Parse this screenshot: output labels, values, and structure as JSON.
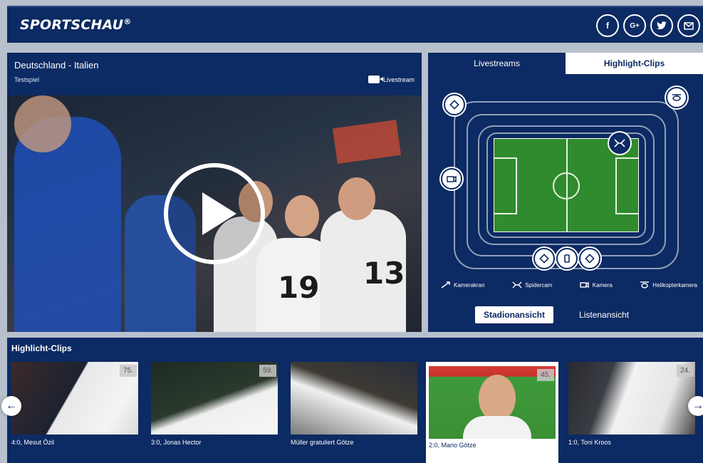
{
  "header": {
    "logo": "SPORTSCHAU",
    "logo_mark": "®",
    "social": [
      {
        "label": "f",
        "icon": "facebook-icon"
      },
      {
        "label": "G+",
        "icon": "google-plus-icon"
      },
      {
        "label": "",
        "icon": "twitter-icon"
      },
      {
        "label": "",
        "icon": "mail-icon"
      }
    ]
  },
  "video": {
    "title": "Deutschland - Italien",
    "subtitle": "Testspiel",
    "livestream_label": "Livestream"
  },
  "stadium": {
    "tabs": {
      "livestreams": "Livestreams",
      "highlights": "Highlight-Clips"
    },
    "legend": {
      "kamerakran": "Kamerakran",
      "spidercam": "Spidercam",
      "kamera": "Kamera",
      "helikopter": "Helikopterkamera"
    },
    "views": {
      "stadion": "Stadionansicht",
      "liste": "Listenansicht"
    }
  },
  "clips": {
    "title": "Highlicht-Clips",
    "items": [
      {
        "minute": "75.",
        "caption": "4:0, Mesut Özil"
      },
      {
        "minute": "59.",
        "caption": "3:0, Jonas Hector"
      },
      {
        "minute": "",
        "caption": "Müller gratuliert Götze"
      },
      {
        "minute": "45.",
        "caption": "2:0, Mario Götze"
      },
      {
        "minute": "24.",
        "caption": "1:0, Toni Kroos"
      }
    ]
  },
  "colors": {
    "brand": "#0c2a63",
    "pitch": "#2f8b2d"
  }
}
